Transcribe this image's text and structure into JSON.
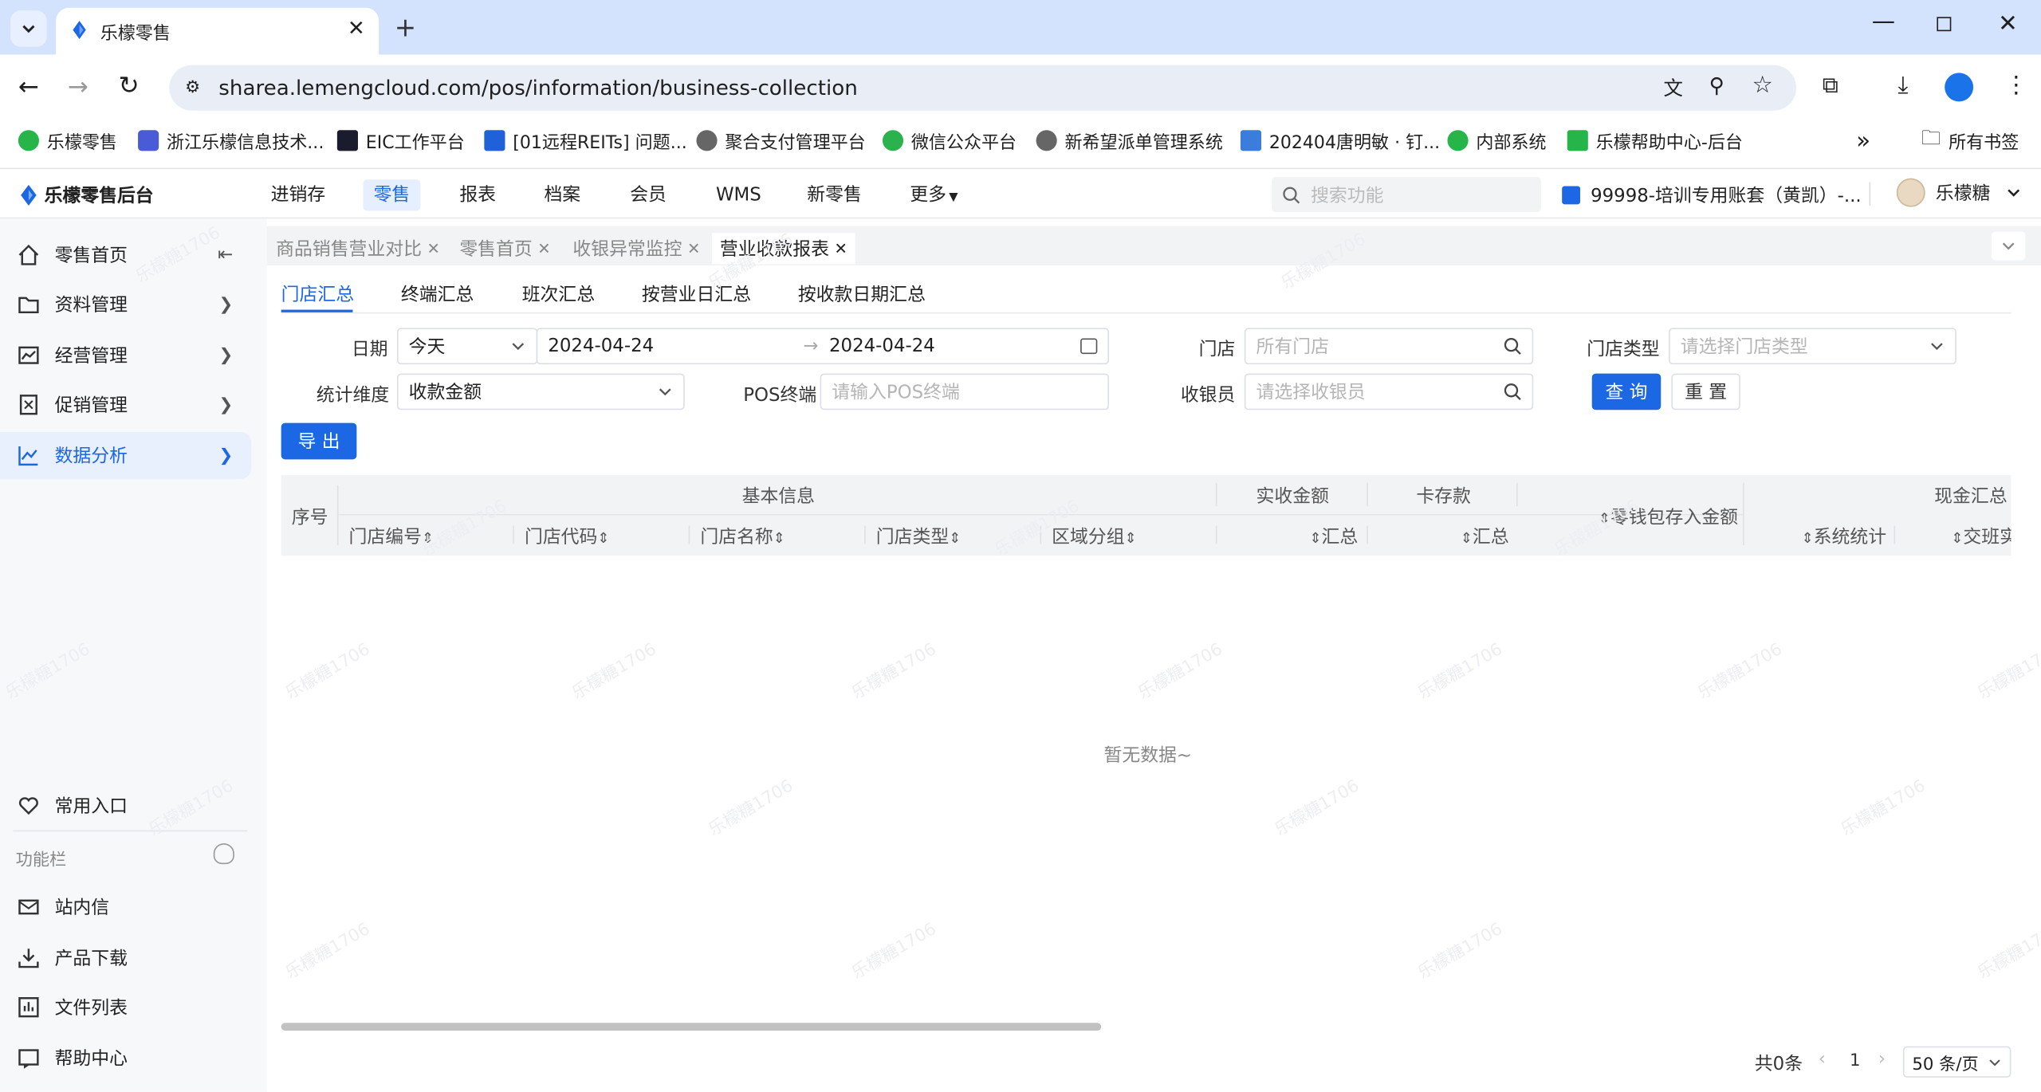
{
  "browser": {
    "tab_title": "乐檬零售",
    "url": "sharea.lemengcloud.com/pos/information/business-collection",
    "bookmarks": [
      "乐檬零售",
      "浙江乐檬信息技术...",
      "EIC工作平台",
      "[01远程REITs] 问题...",
      "聚合支付管理平台",
      "微信公众平台",
      "新希望派单管理系统",
      "202404唐明敏 · 钉...",
      "内部系统",
      "乐檬帮助中心-后台"
    ],
    "all_bookmarks": "所有书签",
    "overflow": "»"
  },
  "header": {
    "logo": "乐檬零售后台",
    "nav": [
      "进销存",
      "零售",
      "报表",
      "档案",
      "会员",
      "WMS",
      "新零售",
      "更多"
    ],
    "search_placeholder": "搜索功能",
    "account": "99998-培训专用账套（黄凯）-...",
    "user": "乐檬糖"
  },
  "sidebar": {
    "items": [
      "零售首页",
      "资料管理",
      "经营管理",
      "促销管理",
      "数据分析"
    ],
    "favorites": "常用入口",
    "section": "功能栏",
    "bottom": [
      "站内信",
      "产品下载",
      "文件列表",
      "帮助中心"
    ]
  },
  "page_tabs": [
    "商品销售营业对比",
    "零售首页",
    "收银异常监控",
    "营业收款报表"
  ],
  "sub_tabs": [
    "门店汇总",
    "终端汇总",
    "班次汇总",
    "按营业日汇总",
    "按收款日期汇总"
  ],
  "filters": {
    "date_label": "日期",
    "date_range": "今天",
    "date_start": "2024-04-24",
    "date_end": "2024-04-24",
    "store_label": "门店",
    "store_placeholder": "所有门店",
    "store_type_label": "门店类型",
    "store_type_placeholder": "请选择门店类型",
    "dimension_label": "统计维度",
    "dimension_value": "收款金额",
    "pos_label": "POS终端",
    "pos_placeholder": "请输入POS终端",
    "cashier_label": "收银员",
    "cashier_placeholder": "请选择收银员",
    "query": "查 询",
    "reset": "重 置",
    "export": "导 出"
  },
  "table": {
    "seq": "序号",
    "group_basic": "基本信息",
    "group_received": "实收金额",
    "group_card": "卡存款",
    "change_wallet": "零钱包存入金额",
    "group_cash": "现金汇总",
    "cols": [
      "门店编号",
      "门店代码",
      "门店名称",
      "门店类型",
      "区域分组"
    ],
    "sum": "汇总",
    "sys_stat": "系统统计",
    "shift": "交班实",
    "empty": "暂无数据~"
  },
  "pagination": {
    "total": "共0条",
    "page": "1",
    "size": "50 条/页"
  },
  "watermark": "乐檬糖1706"
}
